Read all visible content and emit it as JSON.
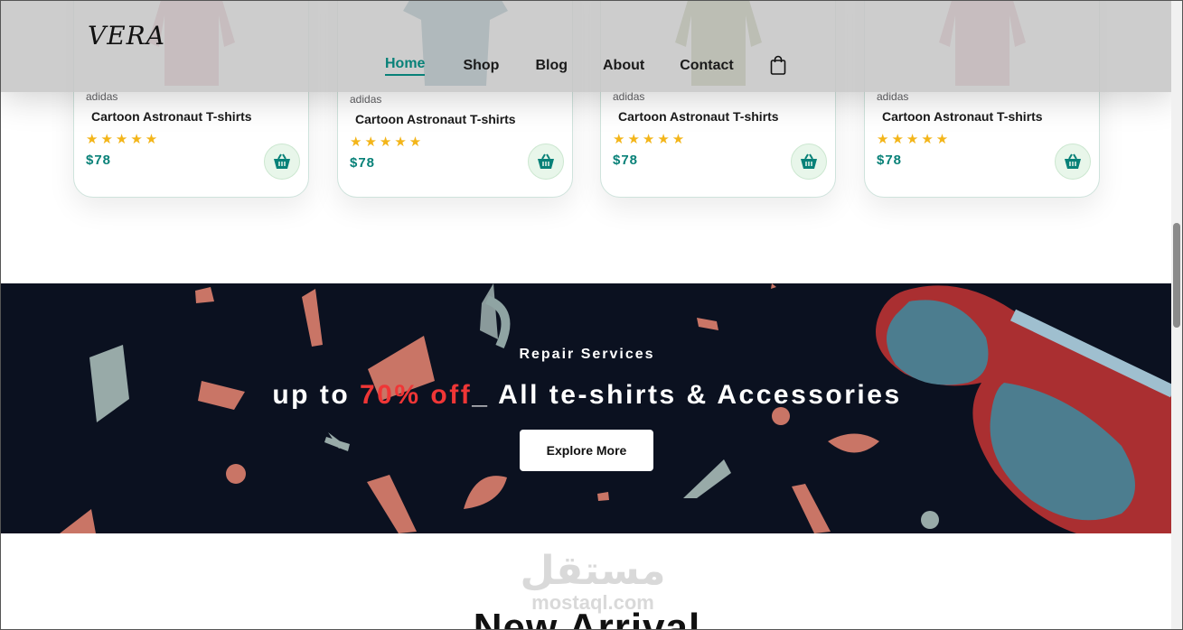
{
  "header": {
    "logo": "VERA",
    "nav": [
      {
        "label": "Home",
        "active": true
      },
      {
        "label": "Shop",
        "active": false
      },
      {
        "label": "Blog",
        "active": false
      },
      {
        "label": "About",
        "active": false
      },
      {
        "label": "Contact",
        "active": false
      }
    ],
    "bag_icon": "shopping-bag-icon"
  },
  "products": [
    {
      "brand": "adidas",
      "title": "Cartoon Astronaut T-shirts",
      "rating": 5,
      "price": "$78",
      "color": "#d4939e",
      "icon": "cart-icon"
    },
    {
      "brand": "adidas",
      "title": "Cartoon Astronaut T-shirts",
      "rating": 5,
      "price": "$78",
      "color": "#3e7a8d",
      "icon": "cart-icon"
    },
    {
      "brand": "adidas",
      "title": "Cartoon Astronaut T-shirts",
      "rating": 5,
      "price": "$78",
      "color": "#8a9a5b",
      "icon": "cart-icon"
    },
    {
      "brand": "adidas",
      "title": "Cartoon Astronaut T-shirts",
      "rating": 5,
      "price": "$78",
      "color": "#d4939e",
      "icon": "cart-icon"
    }
  ],
  "banner": {
    "subtitle": "Repair Services",
    "headline_pre": "up to ",
    "headline_highlight": "70% off",
    "headline_post": "_ All te-shirts & Accessories",
    "button": "Explore More",
    "background": "#0b1120",
    "highlight_color": "#ef3636"
  },
  "watermark": {
    "arabic": "مستقل",
    "latin": "mostaql.com"
  },
  "section_title": "New Arrival",
  "colors": {
    "accent": "#088178",
    "star": "#f3b519"
  }
}
